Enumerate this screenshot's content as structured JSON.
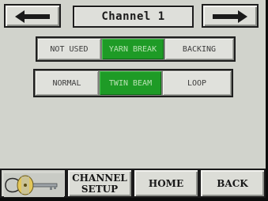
{
  "header": {
    "title": "Channel 1",
    "prev_icon": "arrow-left-icon",
    "next_icon": "arrow-right-icon"
  },
  "groups": {
    "row1": [
      {
        "label": "NOT USED",
        "selected": false
      },
      {
        "label": "YARN BREAK",
        "selected": true
      },
      {
        "label": "BACKING",
        "selected": false
      }
    ],
    "row2": [
      {
        "label": "NORMAL",
        "selected": false
      },
      {
        "label": "TWIN BEAM",
        "selected": true
      },
      {
        "label": "LOOP",
        "selected": false
      }
    ]
  },
  "footer": {
    "key_icon": "key-icon",
    "channel_setup_line1": "CHANNEL",
    "channel_setup_line2": "SETUP",
    "home_label": "HOME",
    "back_label": "BACK"
  },
  "colors": {
    "selected": "#1e9b26",
    "background": "#d1d3cc"
  }
}
